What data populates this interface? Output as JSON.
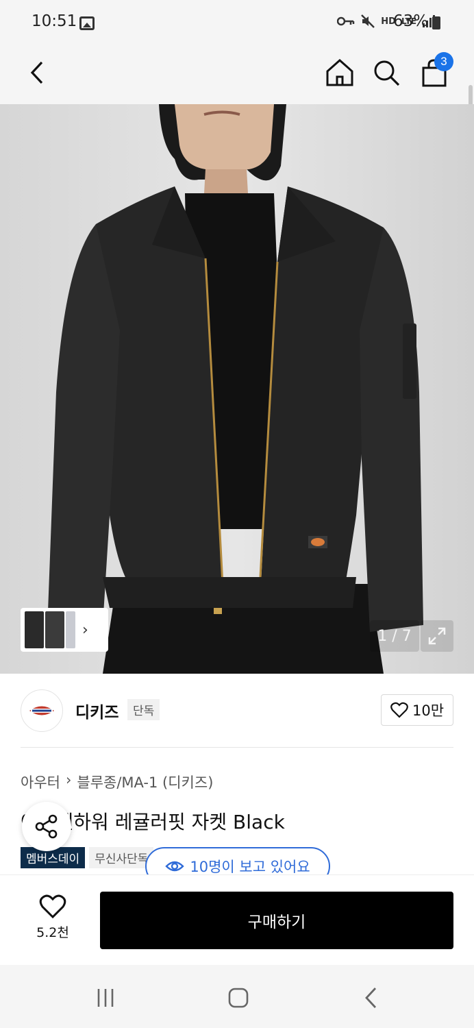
{
  "status_bar": {
    "time": "10:51",
    "battery": "63%",
    "icons": [
      "key-icon",
      "mute-icon",
      "hd-voice-icon",
      "lte-icon",
      "signal-icon"
    ],
    "hd_label": "HD",
    "lte_label": "LTE"
  },
  "header": {
    "cart_count": "3"
  },
  "gallery": {
    "counter": "1 / 7"
  },
  "brand": {
    "name": "디키즈",
    "tag": "단독",
    "likes": "10만"
  },
  "product": {
    "breadcrumb": [
      "아우터",
      "블루종/MA-1 (디키즈)"
    ],
    "title": "아이젠하워 레귤러핏 자켓 Black",
    "badges": [
      "멤버스데이",
      "무신사단독"
    ]
  },
  "viewers": "10명이 보고 있어요",
  "bottom": {
    "wish_count": "5.2천",
    "buy_label": "구매하기"
  },
  "colors": {
    "accent_blue": "#2f6bd8",
    "badge_blue": "#1a73e8",
    "member_badge": "#0d2c4a",
    "buy_button": "#000000"
  }
}
